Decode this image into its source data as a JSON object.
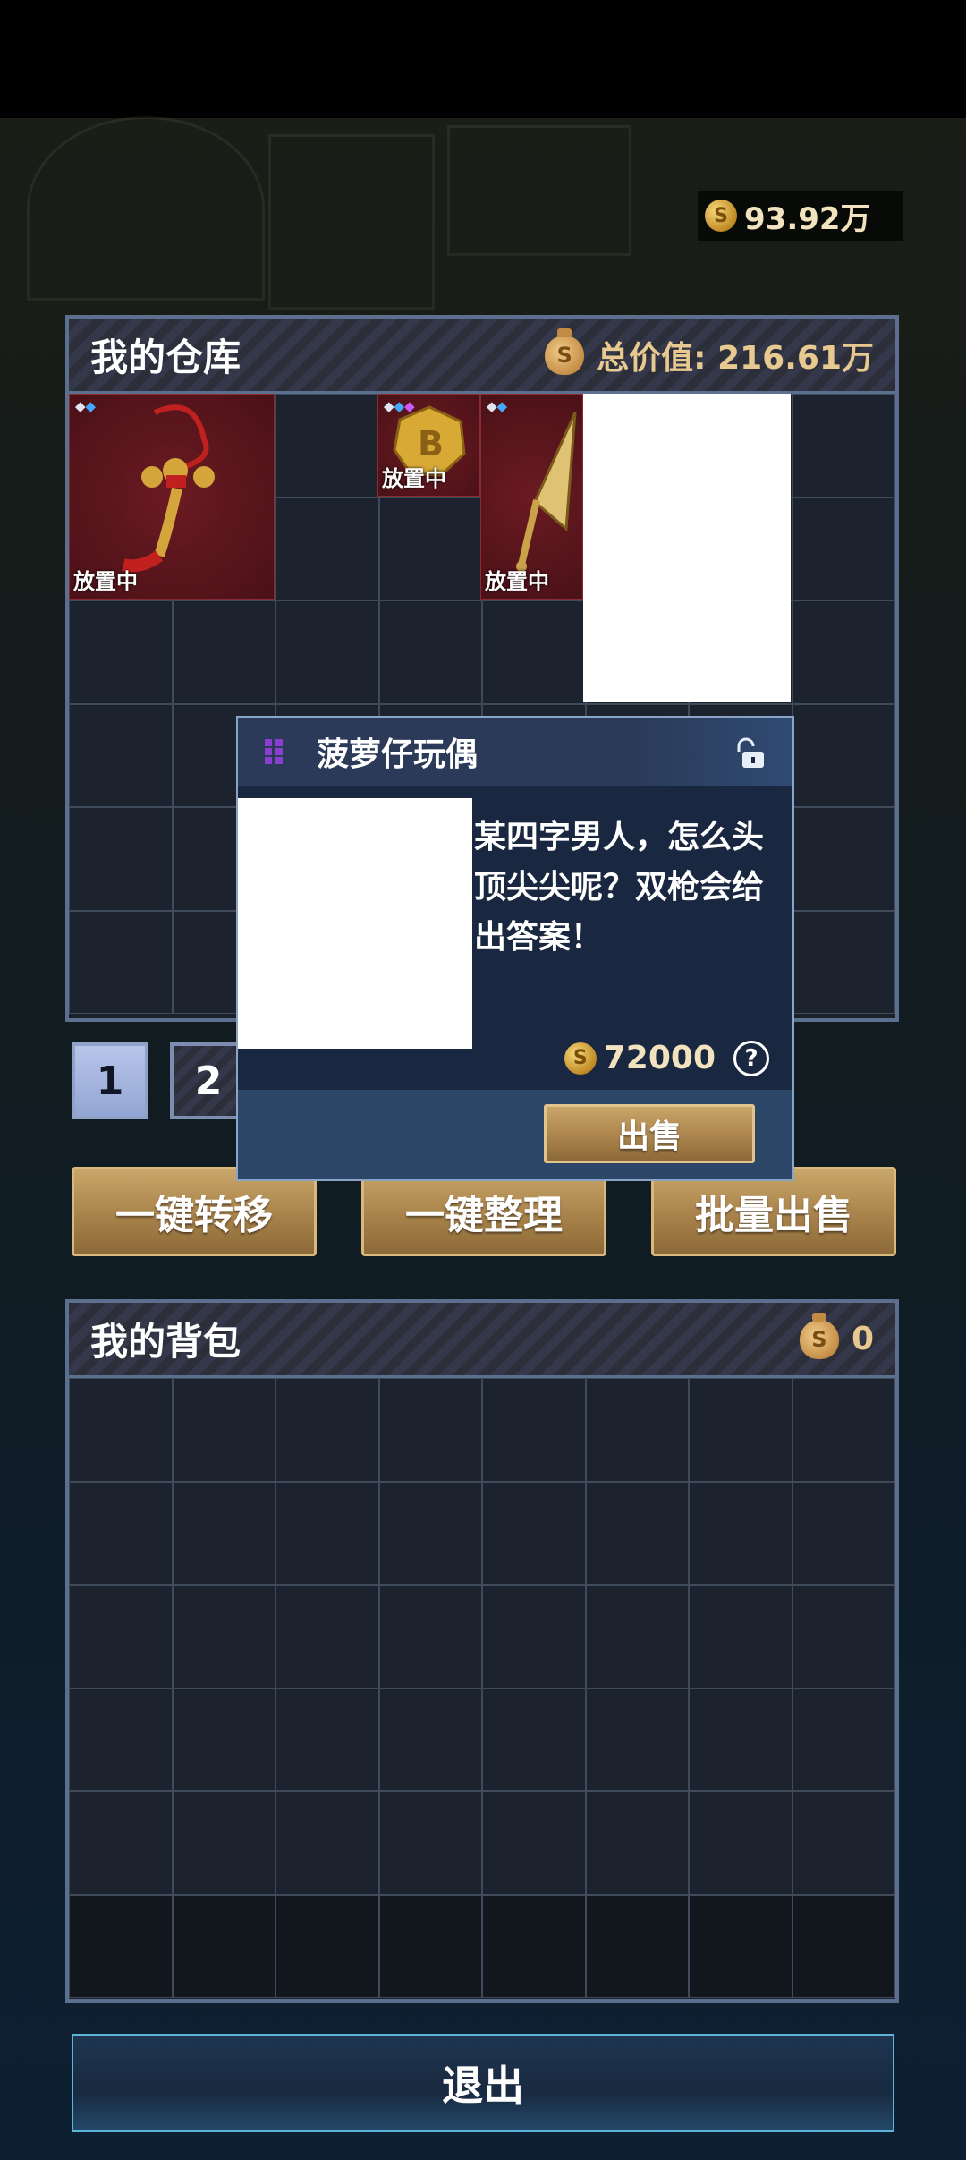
{
  "currency": {
    "amount": "93.92万",
    "icon": "coin-icon"
  },
  "warehouse": {
    "title": "我的仓库",
    "total_value_label": "总价值: 216.61万",
    "items": [
      {
        "name": "red-knot-ornament",
        "tag": "放置中"
      },
      {
        "name": "gold-b-coin",
        "tag": "放置中"
      },
      {
        "name": "golden-spear",
        "tag": "放置中"
      }
    ]
  },
  "pages": [
    "1",
    "2"
  ],
  "actions": {
    "transfer": "一键转移",
    "organize": "一键整理",
    "bulk_sell": "批量出售"
  },
  "backpack": {
    "title": "我的背包",
    "value": "0"
  },
  "exit_label": "退出",
  "popup": {
    "title": "菠萝仔玩偶",
    "description": "某四字男人，怎么头顶尖尖呢？双枪会给出答案！",
    "price": "72000",
    "help": "?",
    "sell_label": "出售",
    "rarity_color": "#8a3fd0"
  }
}
